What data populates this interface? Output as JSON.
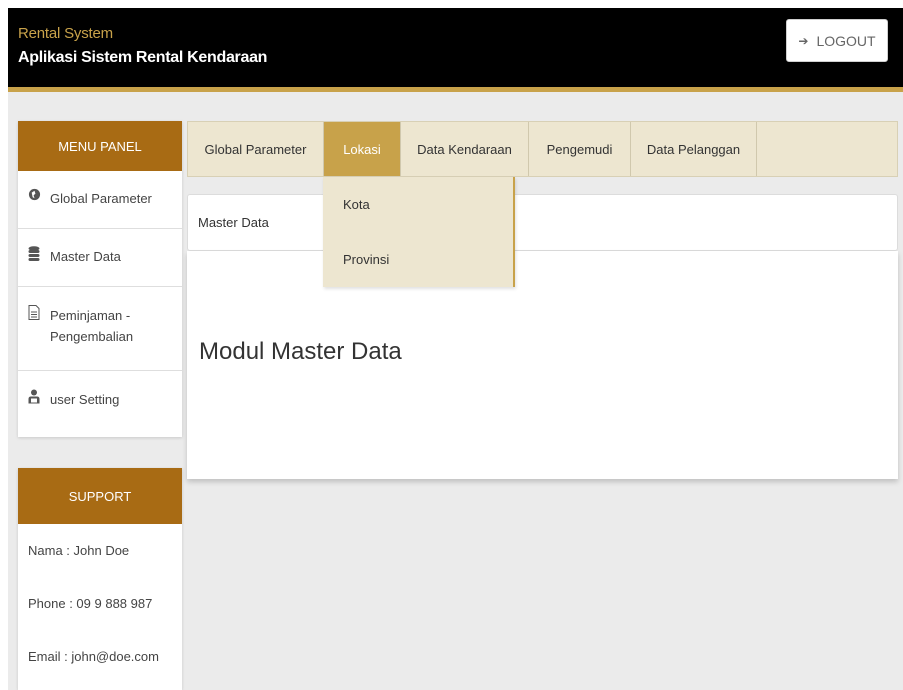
{
  "header": {
    "subtitle": "Rental System",
    "title": "Aplikasi Sistem Rental Kendaraan",
    "logout_label": "LOGOUT",
    "logout_icon": "sign-out-icon"
  },
  "sidebar": {
    "menu_title": "MENU PANEL",
    "items": [
      {
        "label": "Global Parameter",
        "icon": "globe-icon"
      },
      {
        "label": "Master Data",
        "icon": "database-icon"
      },
      {
        "label_line1": "Peminjaman -",
        "label_line2": "Pengembalian",
        "icon": "document-icon"
      },
      {
        "label": "user Setting",
        "icon": "user-icon"
      }
    ],
    "support_title": "SUPPORT",
    "support": {
      "name": "Nama : John Doe",
      "phone": "Phone : 09 9 888 987",
      "email": "Email : john@doe.com"
    }
  },
  "tabs": [
    {
      "label": "Global Parameter",
      "active": false
    },
    {
      "label": "Lokasi",
      "active": true
    },
    {
      "label": "Data Kendaraan",
      "active": false
    },
    {
      "label": "Pengemudi",
      "active": false
    },
    {
      "label": "Data Pelanggan",
      "active": false
    }
  ],
  "dropdown": {
    "items": [
      "Kota",
      "Provinsi"
    ]
  },
  "main": {
    "breadcrumb": "Master Data",
    "module_title": "Modul Master Data"
  },
  "colors": {
    "accent": "#c8a24a",
    "panel_header": "#a86b14",
    "header_bg": "#000000",
    "tab_bg": "#ede6d0"
  }
}
